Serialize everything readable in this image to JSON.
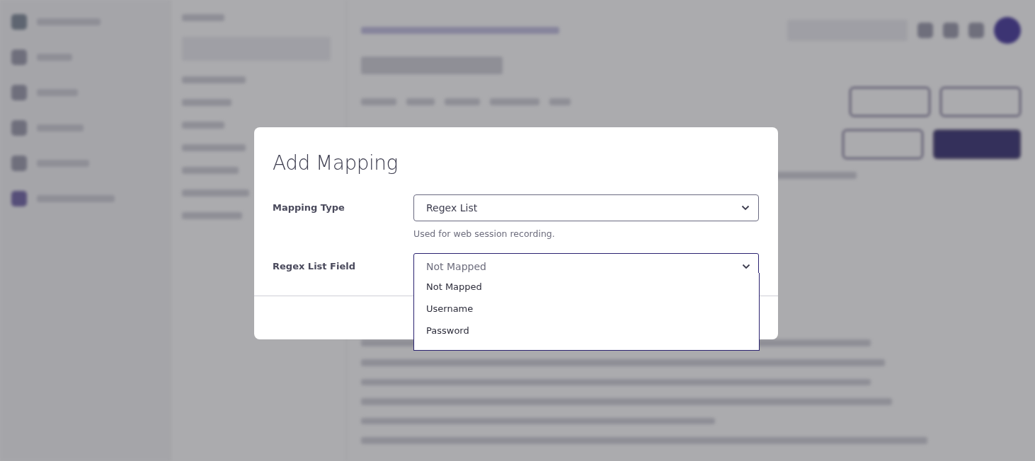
{
  "dialog": {
    "title": "Add Mapping",
    "fields": [
      {
        "kind": "select",
        "label": "Mapping Type",
        "value": "Regex List",
        "hint": "Used for web session recording.",
        "focused": false
      },
      {
        "kind": "combo",
        "label": "Regex List Field",
        "placeholder": "Not Mapped",
        "focused": true
      }
    ],
    "dropdown": {
      "options": [
        {
          "label": "Not Mapped",
          "selected": false
        },
        {
          "label": "Username",
          "selected": false
        },
        {
          "label": "Password",
          "selected": false
        }
      ]
    }
  }
}
